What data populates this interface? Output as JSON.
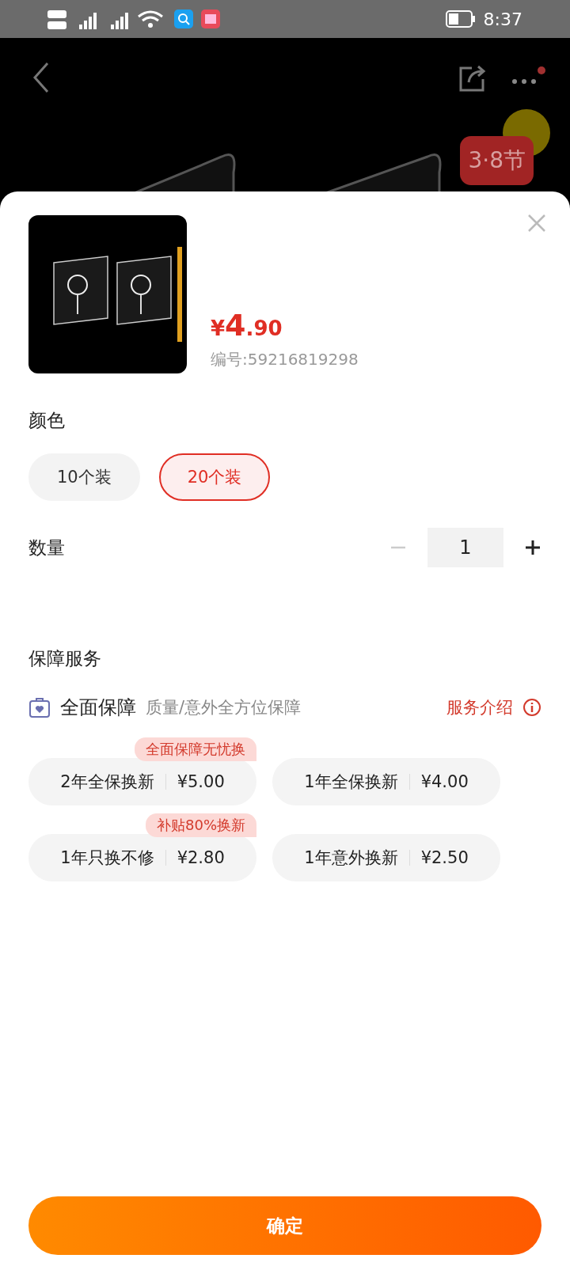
{
  "status_bar": {
    "time": "8:37"
  },
  "header": {
    "badge": "3·8节"
  },
  "product": {
    "price_symbol": "¥",
    "price_int": "4",
    "price_dec": ".90",
    "code": "编号:59216819298"
  },
  "color_section": {
    "title": "颜色",
    "options": [
      {
        "label": "10个装",
        "selected": false
      },
      {
        "label": "20个装",
        "selected": true
      }
    ]
  },
  "quantity": {
    "title": "数量",
    "value": "1",
    "minus_disabled": true
  },
  "service": {
    "title": "保障服务",
    "plan_name": "全面保障",
    "plan_desc": "质量/意外全方位保障",
    "intro_link": "服务介绍",
    "options": [
      {
        "tag": "全面保障无忧换",
        "label": "2年全保换新",
        "price": "¥5.00",
        "selected": false
      },
      {
        "label": "1年全保换新",
        "price": "¥4.00",
        "selected": false
      },
      {
        "tag": "补贴80%换新",
        "label": "1年只换不修",
        "price": "¥2.80",
        "selected": false
      },
      {
        "label": "1年意外换新",
        "price": "¥2.50",
        "selected": false
      }
    ]
  },
  "confirm_button": "确定"
}
